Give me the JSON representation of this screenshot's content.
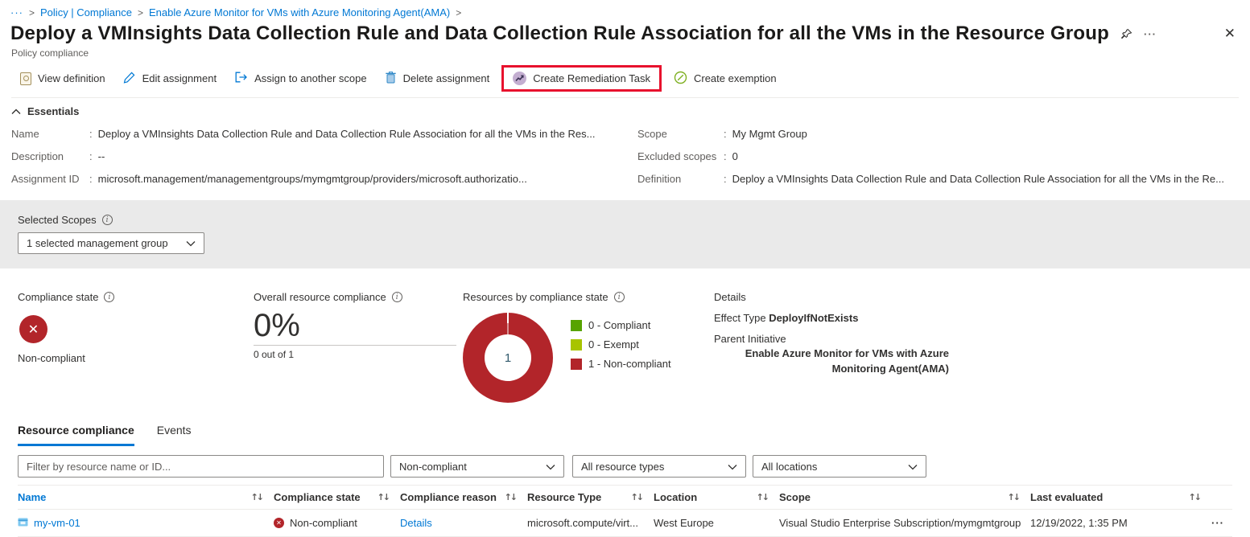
{
  "colors": {
    "accent_blue": "#0078d4",
    "noncompliant_red": "#b2252a",
    "compliant_green": "#57a300",
    "exempt_lime": "#a8c400",
    "highlight_red": "#e8112d",
    "band_gray": "#eaeaea"
  },
  "icons": {
    "breadcrumb_ellipsis": "···",
    "separator": ">",
    "colon": ":",
    "info": "i",
    "sort": "↑↓",
    "x": "✕",
    "close": "✕",
    "header_ellipsis": "···",
    "row_menu": "···"
  },
  "breadcrumb": {
    "items": [
      "Policy | Compliance",
      "Enable Azure Monitor for VMs with Azure Monitoring Agent(AMA)"
    ]
  },
  "header": {
    "title": "Deploy a VMInsights Data Collection Rule and Data Collection Rule Association for all the VMs in the Resource Group",
    "subtitle": "Policy compliance"
  },
  "toolbar": {
    "view_definition": "View definition",
    "edit_assignment": "Edit assignment",
    "assign_scope": "Assign to another scope",
    "delete_assignment": "Delete assignment",
    "create_remediation": "Create Remediation Task",
    "create_exemption": "Create exemption"
  },
  "essentials": {
    "toggle_label": "Essentials",
    "left": [
      {
        "label": "Name",
        "value": "Deploy a VMInsights Data Collection Rule and Data Collection Rule Association for all the VMs in the Res..."
      },
      {
        "label": "Description",
        "value": "--"
      },
      {
        "label": "Assignment ID",
        "value": "microsoft.management/managementgroups/mymgmtgroup/providers/microsoft.authorizatio..."
      }
    ],
    "right": [
      {
        "label": "Scope",
        "value": "My Mgmt Group"
      },
      {
        "label": "Excluded scopes",
        "value": "0"
      },
      {
        "label": "Definition",
        "value": "Deploy a VMInsights Data Collection Rule and Data Collection Rule Association for all the VMs in the Re..."
      }
    ]
  },
  "scopes": {
    "label": "Selected Scopes",
    "dropdown_value": "1 selected management group"
  },
  "compliance": {
    "state": {
      "label": "Compliance state",
      "value": "Non-compliant"
    },
    "overall": {
      "label": "Overall resource compliance",
      "percent": "0%",
      "detail": "0 out of 1"
    },
    "chart": {
      "label": "Resources by compliance state",
      "center": "1",
      "legend": [
        {
          "label": "0 - Compliant",
          "color": "#57a300"
        },
        {
          "label": "0 - Exempt",
          "color": "#a8c400"
        },
        {
          "label": "1 - Non-compliant",
          "color": "#b2252a"
        }
      ]
    },
    "details": {
      "label": "Details",
      "effect_type_label": "Effect Type",
      "effect_type_value": "DeployIfNotExists",
      "parent_initiative_label": "Parent Initiative",
      "parent_initiative_value": "Enable Azure Monitor for VMs with Azure Monitoring Agent(AMA)"
    }
  },
  "chart_data": {
    "type": "pie",
    "title": "Resources by compliance state",
    "categories": [
      "Compliant",
      "Exempt",
      "Non-compliant"
    ],
    "values": [
      0,
      0,
      1
    ],
    "colors": [
      "#57a300",
      "#a8c400",
      "#b2252a"
    ],
    "center_label": "1",
    "legend_position": "right"
  },
  "tabs": [
    {
      "label": "Resource compliance",
      "active": true
    },
    {
      "label": "Events",
      "active": false
    }
  ],
  "filters": {
    "search_placeholder": "Filter by resource name or ID...",
    "compliance_state": "Non-compliant",
    "resource_types": "All resource types",
    "locations": "All locations"
  },
  "table": {
    "columns": [
      "Name",
      "Compliance state",
      "Compliance reason",
      "Resource Type",
      "Location",
      "Scope",
      "Last evaluated"
    ],
    "rows": [
      {
        "name": "my-vm-01",
        "compliance_state": "Non-compliant",
        "compliance_reason": "Details",
        "resource_type": "microsoft.compute/virt...",
        "location": "West Europe",
        "scope": "Visual Studio Enterprise Subscription/mymgmtgroup",
        "last_evaluated": "12/19/2022, 1:35 PM"
      }
    ]
  }
}
